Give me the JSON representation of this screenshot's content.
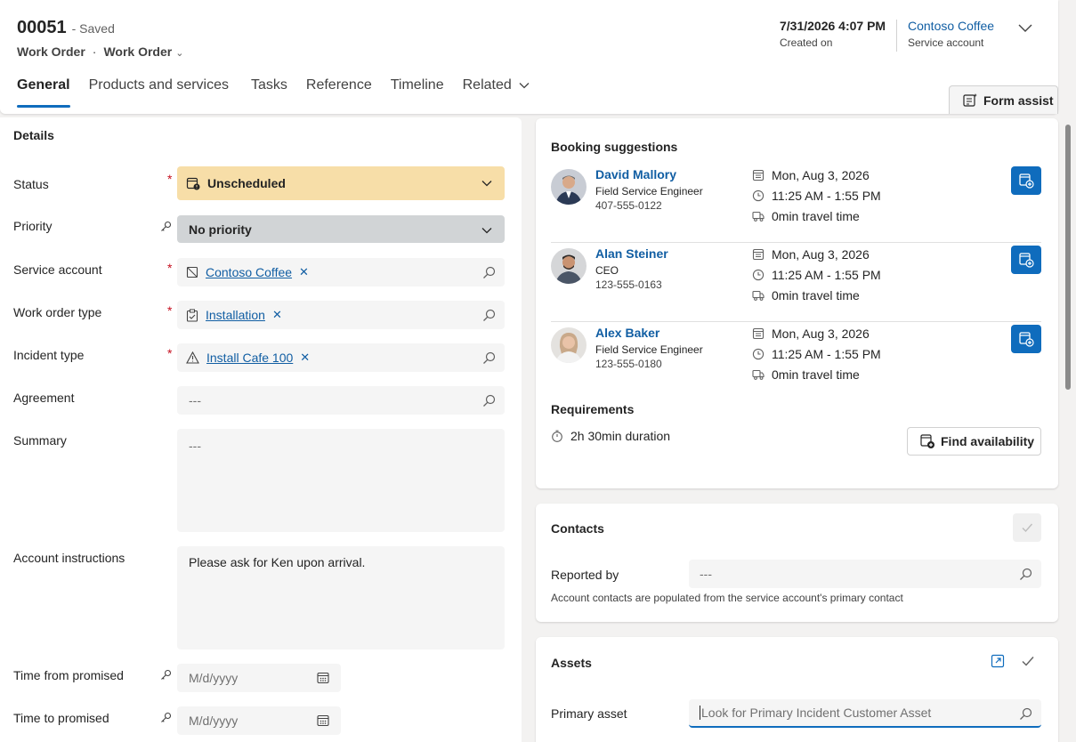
{
  "header": {
    "record_id": "00051",
    "save_state": "- Saved",
    "entity": "Work Order",
    "dot": "·",
    "form_selector": "Work Order",
    "created_on_value": "7/31/2026 4:07 PM",
    "created_on_label": "Created on",
    "service_account_value": "Contoso Coffee",
    "service_account_label": "Service account"
  },
  "tabs": [
    {
      "label": "General",
      "active": true
    },
    {
      "label": "Products and services"
    },
    {
      "label": "Tasks"
    },
    {
      "label": "Reference"
    },
    {
      "label": "Timeline"
    },
    {
      "label": "Related"
    }
  ],
  "form_assist": "Form assist",
  "details": {
    "title": "Details",
    "status": {
      "label": "Status",
      "required": "*",
      "value": "Unscheduled"
    },
    "priority": {
      "label": "Priority",
      "value": "No priority"
    },
    "service_account": {
      "label": "Service account",
      "required": "*",
      "value": "Contoso Coffee",
      "remove": "✕"
    },
    "work_order_type": {
      "label": "Work order type",
      "required": "*",
      "value": "Installation",
      "remove": "✕"
    },
    "incident_type": {
      "label": "Incident type",
      "required": "*",
      "value": "Install Cafe 100",
      "remove": "✕"
    },
    "agreement": {
      "label": "Agreement",
      "value": "---"
    },
    "summary": {
      "label": "Summary",
      "value": "---"
    },
    "account_instructions": {
      "label": "Account instructions",
      "value": "Please ask for Ken upon arrival."
    },
    "time_from_promised": {
      "label": "Time from promised",
      "placeholder": "M/d/yyyy"
    },
    "time_to_promised": {
      "label": "Time to promised",
      "placeholder": "M/d/yyyy"
    }
  },
  "booking": {
    "title": "Booking suggestions",
    "suggestions": [
      {
        "name": "David Mallory",
        "role": "Field Service Engineer",
        "phone": "407-555-0122",
        "date": "Mon, Aug 3, 2026",
        "time": "11:25 AM - 1:55 PM",
        "travel": "0min travel time"
      },
      {
        "name": "Alan Steiner",
        "role": "CEO",
        "phone": "123-555-0163",
        "date": "Mon, Aug 3, 2026",
        "time": "11:25 AM - 1:55 PM",
        "travel": "0min travel time"
      },
      {
        "name": "Alex Baker",
        "role": "Field Service Engineer",
        "phone": "123-555-0180",
        "date": "Mon, Aug 3, 2026",
        "time": "11:25 AM - 1:55 PM",
        "travel": "0min travel time"
      }
    ],
    "requirements_title": "Requirements",
    "duration": "2h 30min duration",
    "find_availability": "Find availability"
  },
  "contacts": {
    "title": "Contacts",
    "reported_by_label": "Reported by",
    "reported_by_value": "---",
    "hint": "Account contacts are populated from the service account's primary contact"
  },
  "assets": {
    "title": "Assets",
    "primary_asset_label": "Primary asset",
    "primary_asset_placeholder": "Look for Primary Incident Customer Asset"
  },
  "colors": {
    "accent": "#0f6cbd",
    "link": "#115ea3",
    "status_bg": "#f7dea8",
    "required": "#c50f1f"
  }
}
